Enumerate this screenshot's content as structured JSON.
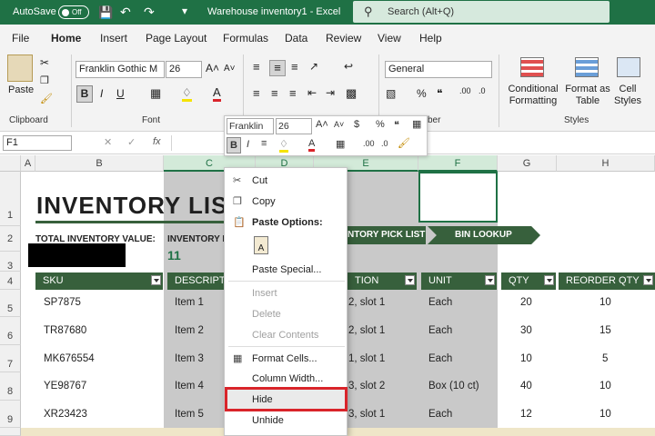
{
  "titlebar": {
    "autosave_label": "AutoSave",
    "toggle_state": "Off",
    "doc_title": "Warehouse inventory1  -  Excel",
    "search_placeholder": "Search (Alt+Q)"
  },
  "menu": [
    "File",
    "Home",
    "Insert",
    "Page Layout",
    "Formulas",
    "Data",
    "Review",
    "View",
    "Help"
  ],
  "ribbon": {
    "clipboard": {
      "paste": "Paste",
      "label": "Clipboard"
    },
    "font": {
      "name": "Franklin Gothic M",
      "size": "26",
      "label": "Font"
    },
    "number": {
      "format": "General",
      "label_partial": "ber"
    },
    "styles": {
      "cond": "Conditional Formatting",
      "format_as": "Format as Table",
      "cell_styles": "Cell Styles",
      "label": "Styles"
    }
  },
  "formula": {
    "namebox": "F1",
    "fx": "fx"
  },
  "columns": [
    "A",
    "B",
    "C",
    "D",
    "E",
    "F",
    "G",
    "H"
  ],
  "rows": [
    "1",
    "2",
    "3",
    "4",
    "5",
    "6",
    "7",
    "8",
    "9"
  ],
  "sheet": {
    "title": "INVENTORY LIST",
    "total_label": "TOTAL INVENTORY VALUE:",
    "inv_label": "INVENTORY I",
    "inv_value": "11",
    "banner1": "NTORY PICK LIST",
    "banner2": "BIN LOOKUP",
    "headers": {
      "sku": "SKU",
      "desc": "DESCRIPT",
      "loc": "TION",
      "unit": "UNIT",
      "qty": "QTY",
      "reorder": "REORDER QTY"
    },
    "data": [
      {
        "sku": "SP7875",
        "desc": "Item 1",
        "loc": "2, slot 1",
        "unit": "Each",
        "qty": "20",
        "reorder": "10"
      },
      {
        "sku": "TR87680",
        "desc": "Item 2",
        "loc": "2, slot 1",
        "unit": "Each",
        "qty": "30",
        "reorder": "15"
      },
      {
        "sku": "MK676554",
        "desc": "Item 3",
        "loc": "1, slot 1",
        "unit": "Each",
        "qty": "10",
        "reorder": "5"
      },
      {
        "sku": "YE98767",
        "desc": "Item 4",
        "loc": "3, slot 2",
        "unit": "Box (10 ct)",
        "qty": "40",
        "reorder": "10"
      },
      {
        "sku": "XR23423",
        "desc": "Item 5",
        "loc": "3, slot 1",
        "unit": "Each",
        "qty": "12",
        "reorder": "10"
      }
    ]
  },
  "minitoolbar": {
    "font": "Franklin",
    "size": "26"
  },
  "context_menu": {
    "cut": "Cut",
    "copy": "Copy",
    "paste_options": "Paste Options:",
    "paste_special": "Paste Special...",
    "insert": "Insert",
    "delete": "Delete",
    "clear": "Clear Contents",
    "format_cells": "Format Cells...",
    "col_width": "Column Width...",
    "hide": "Hide",
    "unhide": "Unhide"
  },
  "colors": {
    "brand": "#1f7145",
    "header_bg": "#37603c",
    "highlight": "#d9242a"
  }
}
